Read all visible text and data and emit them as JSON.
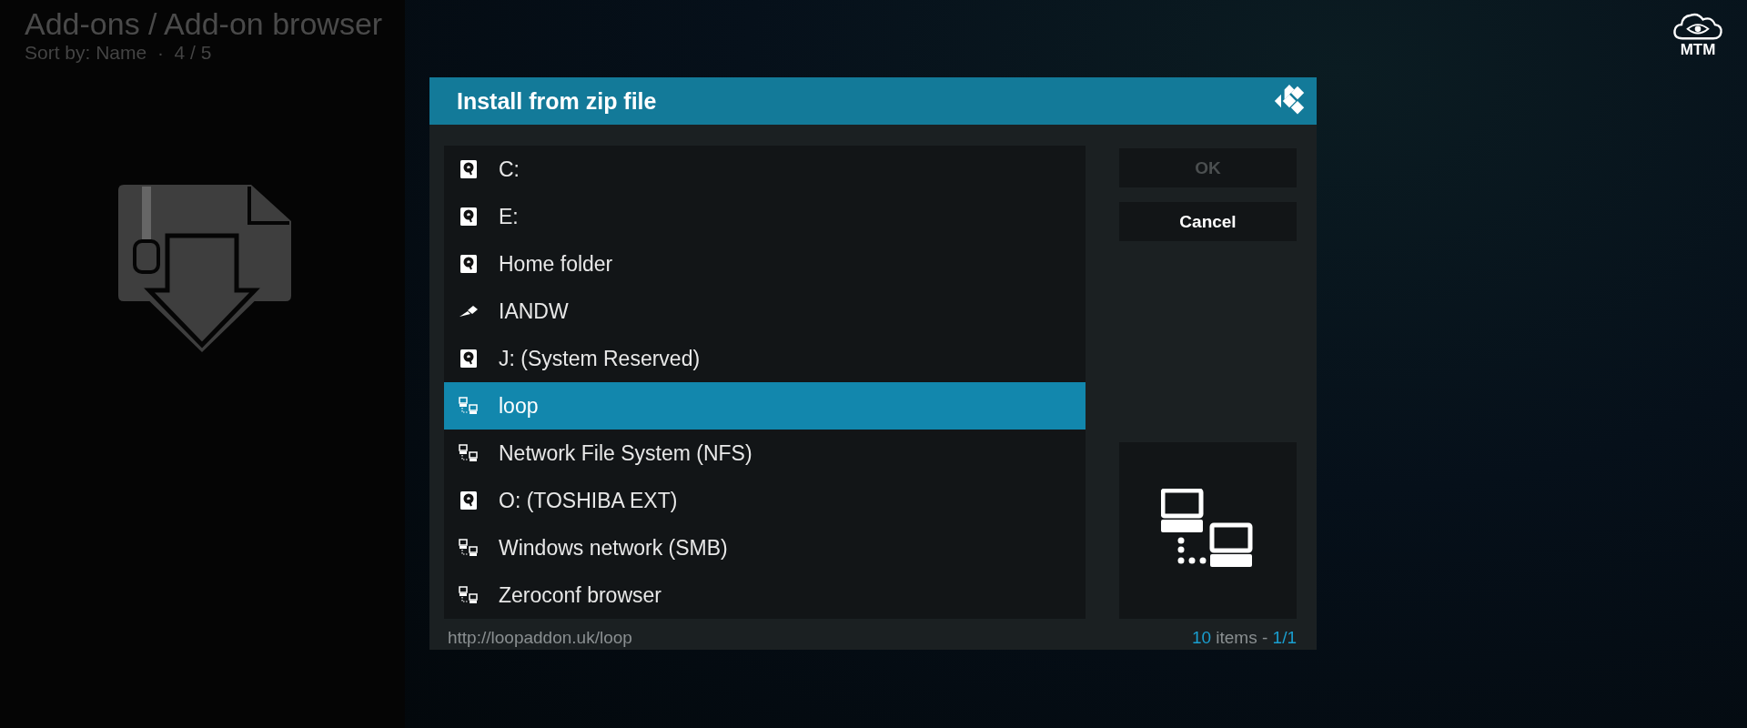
{
  "header": {
    "title": "Add-ons / Add-on browser",
    "subtitle": "Sort by: Name  ·  4 / 5"
  },
  "logo": {
    "text": "MTM"
  },
  "dialog": {
    "title": "Install from zip file",
    "items": [
      {
        "label": "C:",
        "kind": "drive",
        "selected": false
      },
      {
        "label": "E:",
        "kind": "drive",
        "selected": false
      },
      {
        "label": "Home folder",
        "kind": "drive",
        "selected": false
      },
      {
        "label": "IANDW",
        "kind": "usb",
        "selected": false
      },
      {
        "label": "J: (System Reserved)",
        "kind": "drive",
        "selected": false
      },
      {
        "label": "loop",
        "kind": "network",
        "selected": true
      },
      {
        "label": "Network File System (NFS)",
        "kind": "network",
        "selected": false
      },
      {
        "label": "O: (TOSHIBA EXT)",
        "kind": "drive",
        "selected": false
      },
      {
        "label": "Windows network (SMB)",
        "kind": "network",
        "selected": false
      },
      {
        "label": "Zeroconf browser",
        "kind": "network",
        "selected": false
      }
    ],
    "buttons": [
      {
        "label": "OK",
        "disabled": true
      },
      {
        "label": "Cancel",
        "disabled": false
      }
    ],
    "footer": {
      "path": "http://loopaddon.uk/loop",
      "count": "10",
      "count_word": "items -",
      "page": "1/1"
    }
  }
}
